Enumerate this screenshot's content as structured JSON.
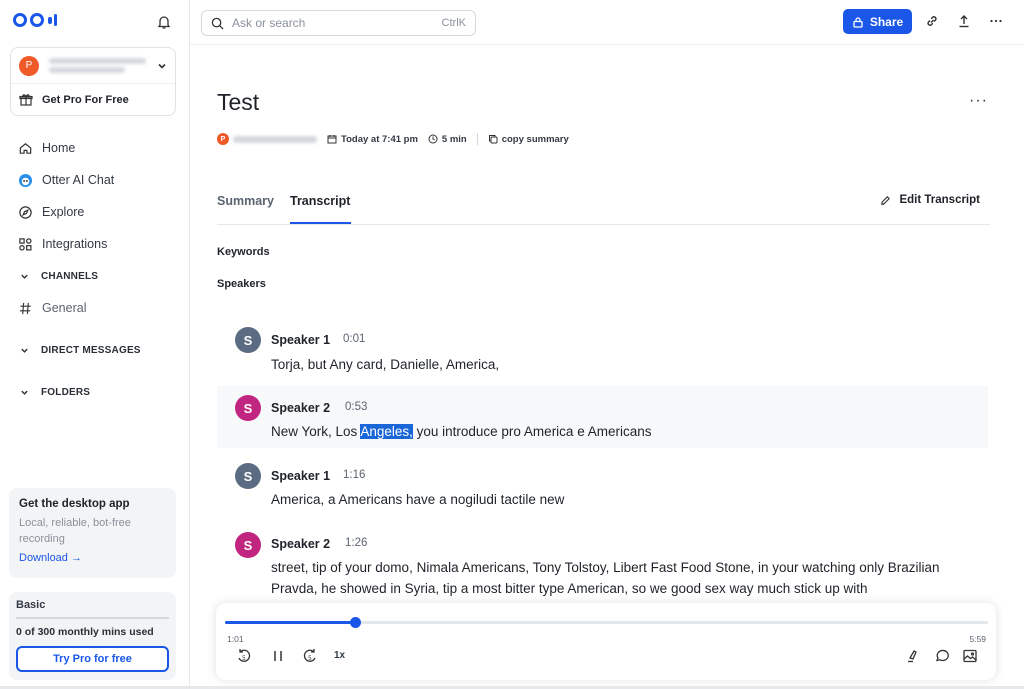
{
  "sidebar": {
    "get_pro_label": "Get Pro For Free",
    "avatar_initial": "P",
    "nav": [
      {
        "label": "Home",
        "icon": "home-icon"
      },
      {
        "label": "Otter AI Chat",
        "icon": "otter-chat-icon"
      },
      {
        "label": "Explore",
        "icon": "compass-icon"
      },
      {
        "label": "Integrations",
        "icon": "integrations-icon"
      }
    ],
    "channels_label": "CHANNELS",
    "channel_general": "General",
    "direct_messages_label": "DIRECT MESSAGES",
    "folders_label": "FOLDERS",
    "desktop_card": {
      "title": "Get the desktop app",
      "subtitle": "Local, reliable, bot-free recording",
      "download": "Download →"
    },
    "plan_card": {
      "plan": "Basic",
      "usage": "0 of 300 monthly mins used",
      "cta": "Try Pro for free",
      "used_fraction": 0
    }
  },
  "topbar": {
    "search_placeholder": "Ask or search",
    "search_shortcut": "CtrlK",
    "share_label": "Share"
  },
  "conversation": {
    "title": "Test",
    "owner_initial": "P",
    "date": "Today at 7:41 pm",
    "duration": "5 min",
    "copy_summary": "copy summary",
    "tabs": [
      "Summary",
      "Transcript"
    ],
    "active_tab": "Transcript",
    "edit_transcript": "Edit Transcript",
    "keywords_label": "Keywords",
    "speakers_label": "Speakers"
  },
  "transcript": [
    {
      "avatar": "S",
      "speaker": "Speaker 1",
      "time": "0:01",
      "text": "Torja, but Any card, Danielle, America,",
      "avatar_color": "#5b6b82"
    },
    {
      "avatar": "S",
      "speaker": "Speaker 2",
      "time": "0:53",
      "text_before": "New York, Los ",
      "text_selected": "Angeles,",
      "text_after": " you introduce pro America e Americans",
      "avatar_color": "#c0267f"
    },
    {
      "avatar": "S",
      "speaker": "Speaker 1",
      "time": "1:16",
      "text": "America, a Americans have a nogiludi tactile new",
      "avatar_color": "#5b6b82"
    },
    {
      "avatar": "S",
      "speaker": "Speaker 2",
      "time": "1:26",
      "text": "street, tip of your domo, Nimala Americans, Tony Tolstoy, Libert Fast Food Stone, in your watching only Brazilian Pravda, he showed in Syria, tip a most bitter type American, so we good sex way much stick up with",
      "avatar_color": "#c0267f"
    }
  ],
  "player": {
    "current_time": "1:01",
    "total_time": "5:59",
    "speed": "1x",
    "progress_fraction": 0.17
  },
  "colors": {
    "accent": "#1a56e8",
    "speaker1": "#5b6b82",
    "speaker2": "#c0267f",
    "avatar_orange": "#f05a28"
  }
}
